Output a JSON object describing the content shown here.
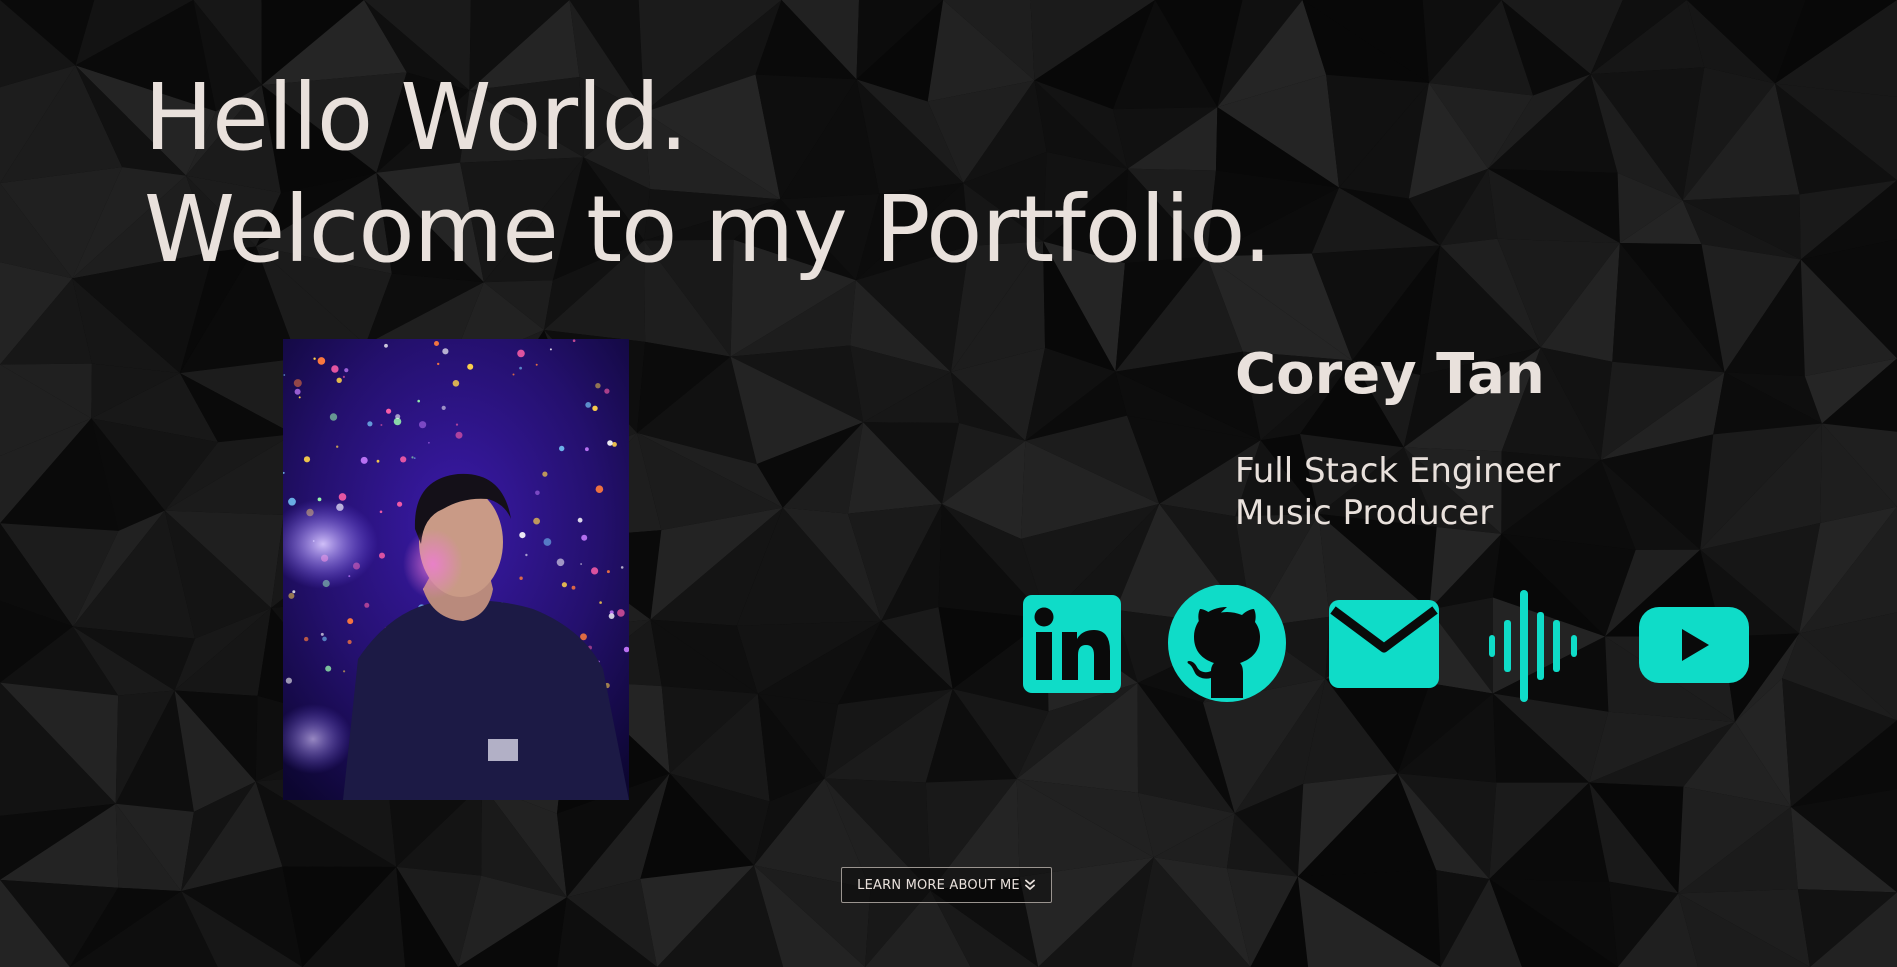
{
  "hero": {
    "line1": "Hello World.",
    "line2": "Welcome to my Portfolio."
  },
  "profile": {
    "name": "Corey Tan",
    "roles": [
      "Full Stack Engineer",
      "Music Producer"
    ]
  },
  "socials": [
    {
      "icon": "linkedin-icon"
    },
    {
      "icon": "github-icon"
    },
    {
      "icon": "mail-icon"
    },
    {
      "icon": "soundwave-icon"
    },
    {
      "icon": "youtube-icon"
    }
  ],
  "cta": {
    "label": "LEARN MORE ABOUT ME"
  },
  "colors": {
    "accent": "#0fdcc8",
    "text": "#e9e1dc",
    "background": "#0b0b0b"
  }
}
